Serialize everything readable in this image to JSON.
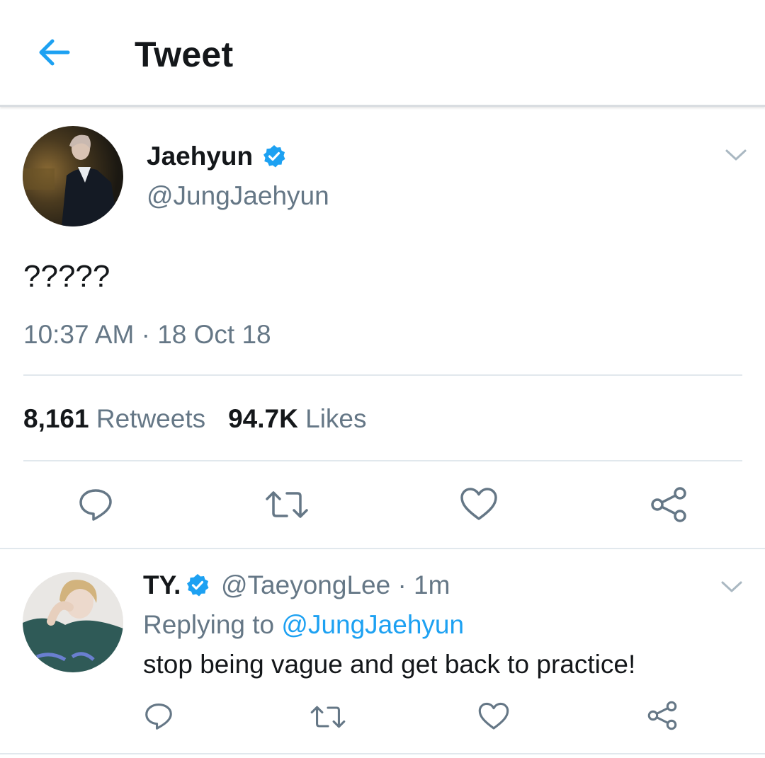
{
  "header": {
    "back_icon": "arrow-left-icon",
    "title": "Tweet",
    "accent_color": "#1da1f2"
  },
  "tweet": {
    "display_name": "Jaehyun",
    "verified": true,
    "handle": "@JungJaehyun",
    "text": "?????",
    "timestamp": "10:37 AM · 18 Oct 18",
    "retweets_count": "8,161",
    "retweets_label": "Retweets",
    "likes_count": "94.7K",
    "likes_label": "Likes",
    "actions": [
      "reply-icon",
      "retweet-icon",
      "like-icon",
      "share-icon"
    ]
  },
  "reply": {
    "display_name": "TY.",
    "verified": true,
    "meta": "@TaeyongLee · 1m",
    "replying_prefix": "Replying to ",
    "replying_to": "@JungJaehyun",
    "text": "stop being vague and get back to practice!",
    "actions": [
      "reply-icon",
      "retweet-icon",
      "like-icon",
      "share-icon"
    ]
  },
  "colors": {
    "text_primary": "#14171a",
    "text_secondary": "#657786",
    "icon_gray": "#657786",
    "divider": "#e1e8ed",
    "verified_blue": "#1da1f2"
  }
}
